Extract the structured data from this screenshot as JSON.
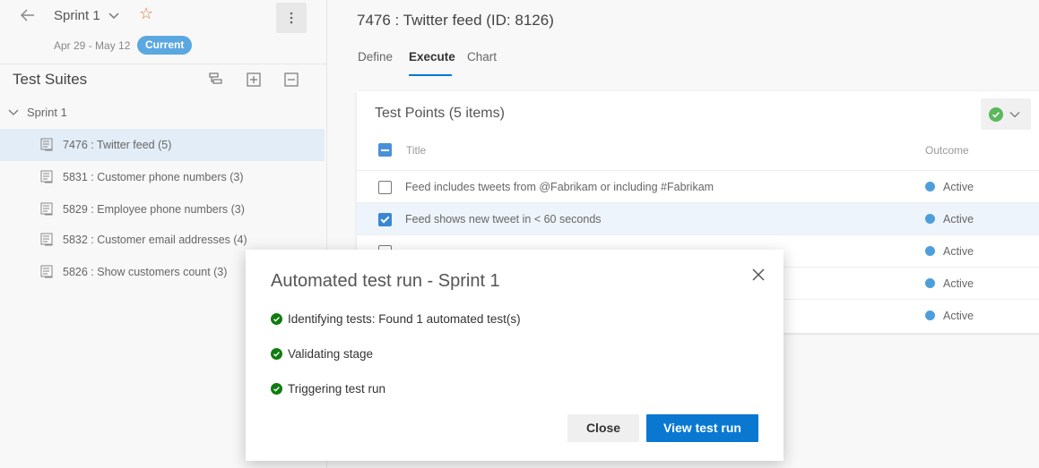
{
  "sidebar": {
    "sprint_title": "Sprint 1",
    "dates": "Apr 29 - May 12",
    "badge": "Current",
    "suites_title": "Test Suites",
    "tree_root": "Sprint 1",
    "suites": [
      {
        "label": "7476 : Twitter feed (5)",
        "selected": true
      },
      {
        "label": "5831 : Customer phone numbers (3)",
        "selected": false
      },
      {
        "label": "5829 : Employee phone numbers (3)",
        "selected": false
      },
      {
        "label": "5832 : Customer email addresses (4)",
        "selected": false
      },
      {
        "label": "5826 : Show customers count (3)",
        "selected": false
      }
    ]
  },
  "main": {
    "title": "7476 : Twitter feed (ID: 8126)",
    "tabs": [
      "Define",
      "Execute",
      "Chart"
    ],
    "active_tab": "Execute",
    "card_title": "Test Points (5 items)",
    "columns": {
      "title": "Title",
      "outcome": "Outcome"
    },
    "rows": [
      {
        "title": "Feed includes tweets from @Fabrikam or including #Fabrikam",
        "outcome": "Active",
        "checked": false
      },
      {
        "title": "Feed shows new tweet in < 60 seconds",
        "outcome": "Active",
        "checked": true
      },
      {
        "title": "",
        "outcome": "Active",
        "checked": false
      },
      {
        "title": "",
        "outcome": "Active",
        "checked": false
      },
      {
        "title": "",
        "outcome": "Active",
        "checked": false
      }
    ]
  },
  "dialog": {
    "title": "Automated test run - Sprint 1",
    "steps": [
      "Identifying tests: Found 1 automated test(s)",
      "Validating stage",
      "Triggering test run"
    ],
    "close_label": "Close",
    "view_label": "View test run"
  },
  "colors": {
    "accent": "#0a78d1",
    "success": "#107c10",
    "active_dot": "#4d9fdc",
    "star": "#e07b39"
  }
}
